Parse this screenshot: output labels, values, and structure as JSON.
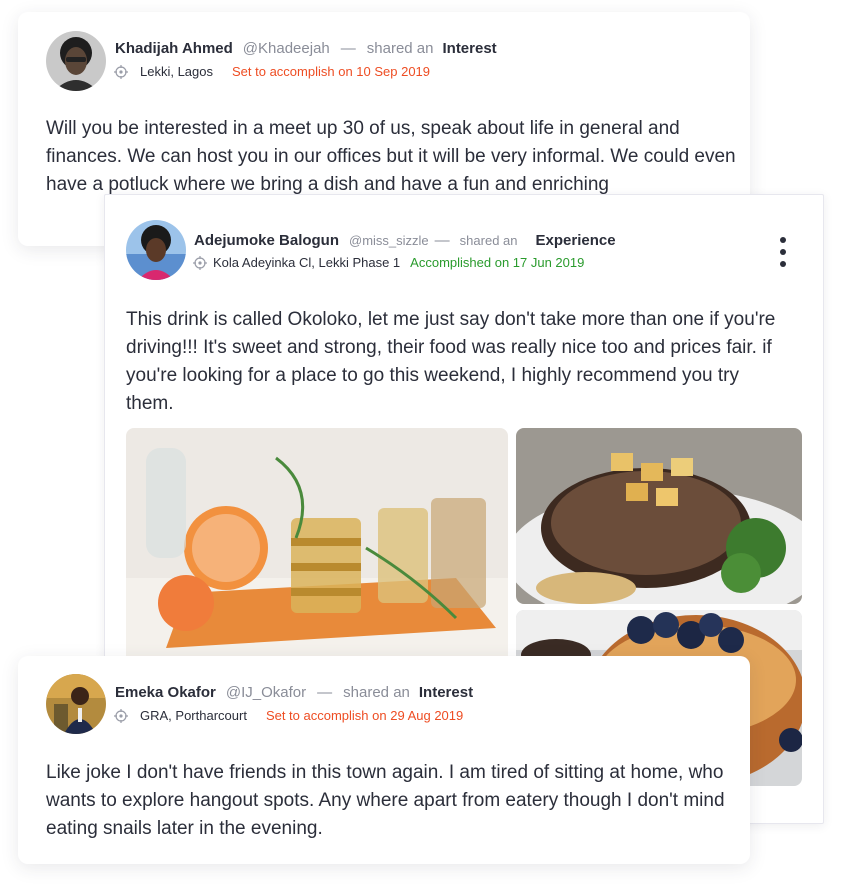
{
  "posts": [
    {
      "author_name": "Khadijah Ahmed",
      "handle": "@Khadeejah",
      "separator": "—",
      "shared_label": "shared an",
      "post_type": "Interest",
      "location": "Lekki, Lagos",
      "status": "Set to accomplish on 10 Sep 2019",
      "status_color": "#ee4d23",
      "body": "Will you be interested in a meet up 30 of us, speak about life in general and finances. We can host you in our offices but it will be very informal. We could even have a potluck where we bring a dish and have a fun and enriching"
    },
    {
      "author_name": "Adejumoke Balogun",
      "handle": "@miss_sizzle",
      "separator": "—",
      "shared_label": "shared an",
      "post_type": "Experience",
      "location": "Kola Adeyinka Cl, Lekki Phase 1",
      "status": "Accomplished on 17 Jun 2019",
      "status_color": "#2a9b2d",
      "body": "This drink is called Okoloko, let me just say don't take more than one if you're driving!!! It's sweet and strong, their food was really nice too and prices fair. if you're looking for a place to go this weekend, I highly recommend you try them.",
      "more_icon": "more-vertical-icon"
    },
    {
      "author_name": "Emeka Okafor",
      "handle": "@IJ_Okafor",
      "separator": "—",
      "shared_label": "shared an",
      "post_type": "Interest",
      "location": "GRA, Portharcourt",
      "status": "Set to accomplish on 29 Aug 2019",
      "status_color": "#ee4d23",
      "body": "Like joke I don't have friends in this town again. I am tired of sitting at home, who wants to explore hangout spots. Any where apart from eatery though I don't mind eating snails later in the evening."
    }
  ],
  "icons": {
    "location": "location-target-icon"
  }
}
